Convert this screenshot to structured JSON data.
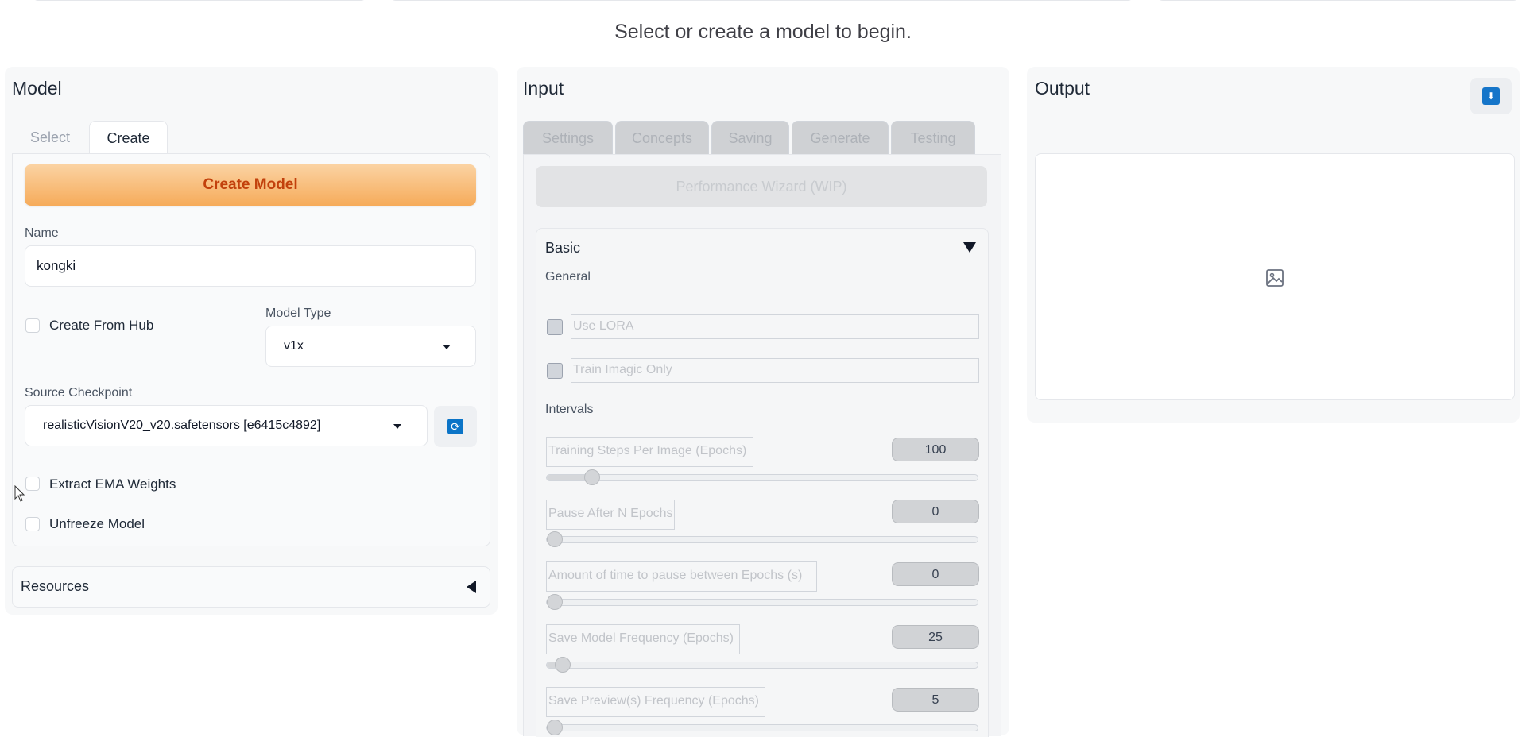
{
  "status_text": "Select or create a model to begin.",
  "model_panel": {
    "title": "Model",
    "tabs": [
      {
        "label": "Select"
      },
      {
        "label": "Create"
      }
    ],
    "create_button": "Create Model",
    "name_label": "Name",
    "name_value": "kongki",
    "create_from_hub_label": "Create From Hub",
    "model_type_label": "Model Type",
    "model_type_value": "v1x",
    "source_checkpoint_label": "Source Checkpoint",
    "source_checkpoint_value": "realisticVisionV20_v20.safetensors [e6415c4892]",
    "extract_ema_label": "Extract EMA Weights",
    "unfreeze_label": "Unfreeze Model",
    "resources_label": "Resources"
  },
  "input_panel": {
    "title": "Input",
    "tabs": [
      {
        "label": "Settings"
      },
      {
        "label": "Concepts"
      },
      {
        "label": "Saving"
      },
      {
        "label": "Generate"
      },
      {
        "label": "Testing"
      }
    ],
    "wizard_button": "Performance Wizard (WIP)",
    "basic_label": "Basic",
    "general_label": "General",
    "use_lora_label": "Use LORA",
    "train_imagic_label": "Train Imagic Only",
    "intervals_label": "Intervals",
    "sliders": [
      {
        "label": "Training Steps Per Image (Epochs)",
        "value": "100",
        "fraction": 0.09
      },
      {
        "label": "Pause After N Epochs",
        "value": "0",
        "fraction": 0
      },
      {
        "label": "Amount of time to pause between Epochs (s)",
        "value": "0",
        "fraction": 0
      },
      {
        "label": "Save Model Frequency (Epochs)",
        "value": "25",
        "fraction": 0.02
      },
      {
        "label": "Save Preview(s) Frequency (Epochs)",
        "value": "5",
        "fraction": 0
      }
    ]
  },
  "output_panel": {
    "title": "Output",
    "image_placeholder_icon": "image-icon",
    "download_icon": "download-icon"
  }
}
